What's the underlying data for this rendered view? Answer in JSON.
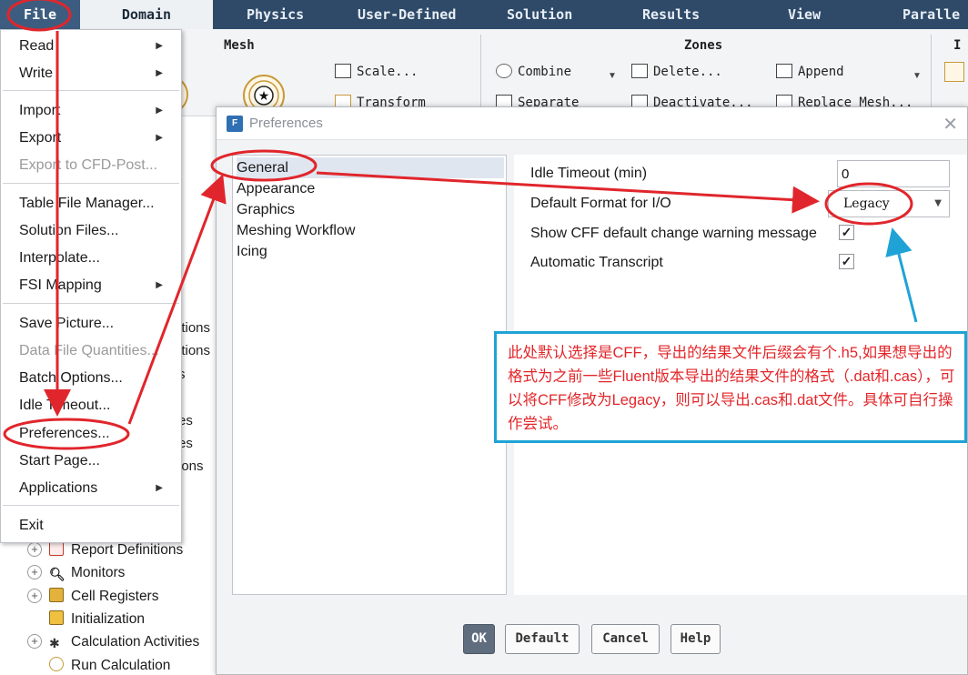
{
  "menubar": {
    "tabs": [
      "File",
      "Domain",
      "Physics",
      "User-Defined",
      "Solution",
      "Results",
      "View",
      "Paralle"
    ]
  },
  "ribbon": {
    "mesh_group_title": "Mesh",
    "zones_group_title": "Zones",
    "partial_group_title": "I",
    "scale_label": "Scale...",
    "transform_label": "Transform",
    "combine_label": "Combine",
    "separate_label": "Separate",
    "delete_label": "Delete...",
    "deactivate_label": "Deactivate...",
    "append_label": "Append",
    "replace_mesh_label": "Replace Mesh..."
  },
  "tree": {
    "fragments": [
      "itions",
      "itions",
      "s",
      "es",
      "es",
      "ions"
    ],
    "items": [
      {
        "label": "Report Definitions",
        "expandable": true
      },
      {
        "label": "Monitors",
        "expandable": true
      },
      {
        "label": "Cell Registers",
        "expandable": true
      },
      {
        "label": "Initialization",
        "expandable": false
      },
      {
        "label": "Calculation Activities",
        "expandable": true
      },
      {
        "label": "Run Calculation",
        "expandable": false
      }
    ]
  },
  "file_menu": {
    "items": [
      {
        "label": "Read",
        "submenu": true,
        "disabled": false
      },
      {
        "label": "Write",
        "submenu": true,
        "disabled": false
      },
      {
        "label": "Import",
        "submenu": true,
        "disabled": false
      },
      {
        "label": "Export",
        "submenu": true,
        "disabled": false
      },
      {
        "label": "Export to CFD-Post...",
        "submenu": false,
        "disabled": true
      },
      {
        "label": "Table File Manager...",
        "submenu": false,
        "disabled": false
      },
      {
        "label": "Solution Files...",
        "submenu": false,
        "disabled": false
      },
      {
        "label": "Interpolate...",
        "submenu": false,
        "disabled": false
      },
      {
        "label": "FSI Mapping",
        "submenu": true,
        "disabled": false
      },
      {
        "label": "Save Picture...",
        "submenu": false,
        "disabled": false
      },
      {
        "label": "Data File Quantities...",
        "submenu": false,
        "disabled": true
      },
      {
        "label": "Batch Options...",
        "submenu": false,
        "disabled": false
      },
      {
        "label": "Idle Timeout...",
        "submenu": false,
        "disabled": false
      },
      {
        "label": "Preferences...",
        "submenu": false,
        "disabled": false
      },
      {
        "label": "Start Page...",
        "submenu": false,
        "disabled": false
      },
      {
        "label": "Applications",
        "submenu": true,
        "disabled": false
      },
      {
        "label": "Exit",
        "submenu": false,
        "disabled": false
      }
    ]
  },
  "dialog": {
    "title": "Preferences",
    "app_icon_letter": "F",
    "close_glyph": "✕",
    "categories": [
      "General",
      "Appearance",
      "Graphics",
      "Meshing Workflow",
      "Icing"
    ],
    "selected_category": "General",
    "settings": {
      "idle_timeout_label": "Idle Timeout (min)",
      "idle_timeout_value": "0",
      "default_format_label": "Default Format for I/O",
      "default_format_value": "Legacy",
      "cff_warning_label": "Show CFF default change warning message",
      "cff_warning_checked": true,
      "auto_transcript_label": "Automatic Transcript",
      "auto_transcript_checked": true
    },
    "buttons": {
      "ok": "OK",
      "default": "Default",
      "cancel": "Cancel",
      "help": "Help"
    }
  },
  "annotation": {
    "text": "此处默认选择是CFF，导出的结果文件后缀会有个.h5,如果想导出的格式为之前一些Fluent版本导出的结果文件的格式（.dat和.cas），可以将CFF修改为Legacy，则可以导出.cas和.dat文件。具体可自行操作尝试。",
    "border_color": "#1fa3d6",
    "text_color": "#e3262a",
    "marker_color": "#e0262c"
  },
  "icons": [
    "file-app-icon",
    "close-icon",
    "chevron-right-icon",
    "chevron-down-icon",
    "checkmark-icon",
    "mesh-icon",
    "scale-icon",
    "transform-icon",
    "combine-icon",
    "separate-icon",
    "delete-icon",
    "deactivate-icon",
    "append-icon",
    "replace-mesh-icon",
    "expand-icon",
    "report-icon",
    "monitor-icon",
    "cell-register-icon",
    "initialization-icon",
    "calculation-icon",
    "run-icon"
  ]
}
